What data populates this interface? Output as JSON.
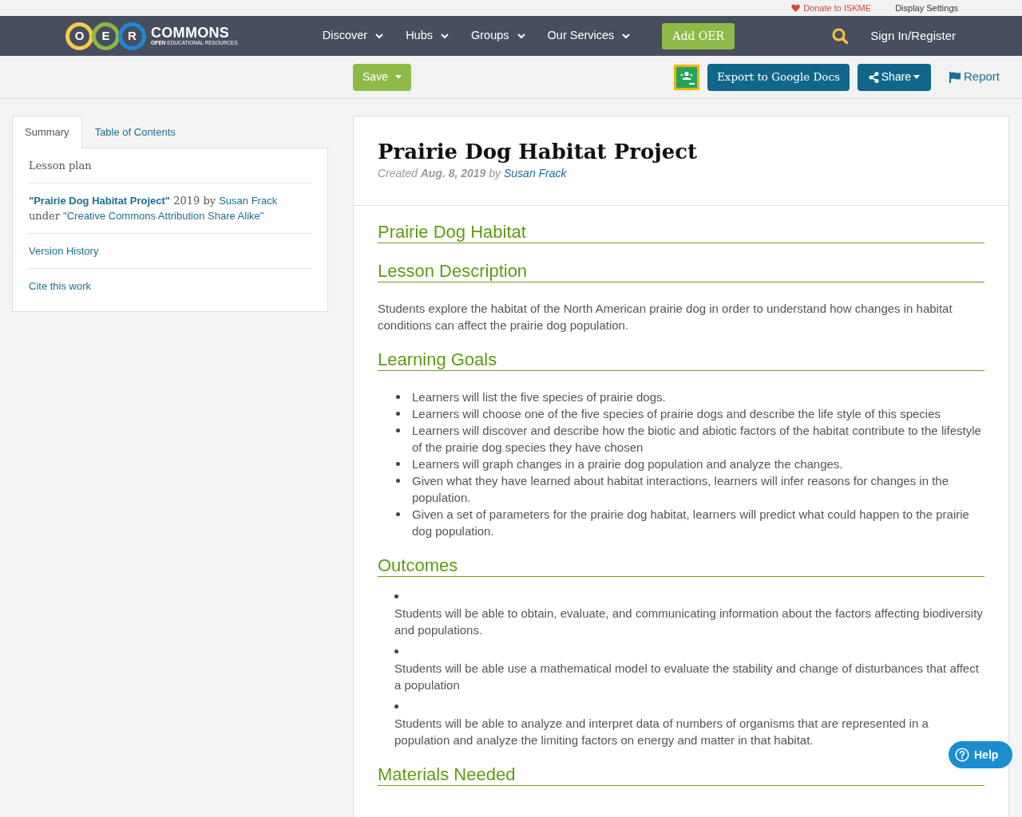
{
  "top_bar": {
    "donate": "Donate to ISKME",
    "display_settings": "Display Settings"
  },
  "navbar": {
    "logo": {
      "letters": [
        {
          "letter": "O",
          "color": "#f6c94b"
        },
        {
          "letter": "E",
          "color": "#8db843"
        },
        {
          "letter": "R",
          "color": "#1e88d2"
        }
      ],
      "wordmark": "COMMONS",
      "tagline": "**OPEN** EDUCATIONAL RESOURCES"
    },
    "menu": [
      {
        "label": "Discover"
      },
      {
        "label": "Hubs"
      },
      {
        "label": "Groups"
      },
      {
        "label": "Our Services"
      }
    ],
    "add_button": "Add OER",
    "sign_in": "Sign In/Register"
  },
  "toolbar": {
    "save": "Save",
    "export": "Export to Google Docs",
    "share": "Share",
    "report": "Report"
  },
  "sidebar": {
    "tabs": [
      {
        "label": "Summary",
        "selected": true
      },
      {
        "label": "Table of Contents",
        "selected": false
      }
    ],
    "material_type": "Lesson plan",
    "attribution": {
      "title": "\"Prairie Dog Habitat Project\"",
      "year_by": "2019 by",
      "author": "Susan Frack",
      "under": "under",
      "license": "\"Creative Commons Attribution Share Alike\""
    },
    "links": [
      "Version History",
      "Cite this work"
    ]
  },
  "resource": {
    "title": "Prairie Dog Habitat Project",
    "created": "Created",
    "date": "Aug. 8, 2019",
    "by": "by",
    "author": "Susan Frack"
  },
  "sections": [
    {
      "heading": "Prairie Dog Habitat"
    },
    {
      "heading": "Lesson Description",
      "blocks": [
        {
          "kind": "paragraph",
          "text": "Students explore the habitat of the North American prairie dog in order to understand how changes in habitat conditions can affect the prairie dog population."
        }
      ]
    },
    {
      "heading": "Learning Goals",
      "blocks": [
        {
          "kind": "list",
          "items": [
            "Learners will list the five species of prairie dogs.",
            "Learners will choose one of the five species of prairie dogs and describe the life style of this species",
            "Learners will discover and describe how the biotic and abiotic factors of the habitat contribute to the lifestyle of the prairie dog species they have chosen",
            "Learners will graph changes in a prairie dog population and analyze the changes.",
            "Given what they have learned about habitat interactions, learners will infer reasons for changes in the population.",
            "Given a set of parameters for the prairie dog habitat, learners will predict what could happen to the prairie dog population."
          ]
        }
      ]
    },
    {
      "heading": "Outcomes",
      "blocks": [
        {
          "kind": "spaced_list",
          "items": [
            "Students will be able to obtain, evaluate, and communicating information about the factors affecting biodiversity and populations.",
            "Students will be able use a mathematical model to evaluate the stability and change of disturbances that affect a population",
            "Students will be able to analyze and interpret data of numbers of organisms that are represented in a population and analyze the limiting factors on energy and matter in that habitat."
          ]
        }
      ]
    },
    {
      "heading": "Materials Needed"
    }
  ],
  "help": "Help"
}
